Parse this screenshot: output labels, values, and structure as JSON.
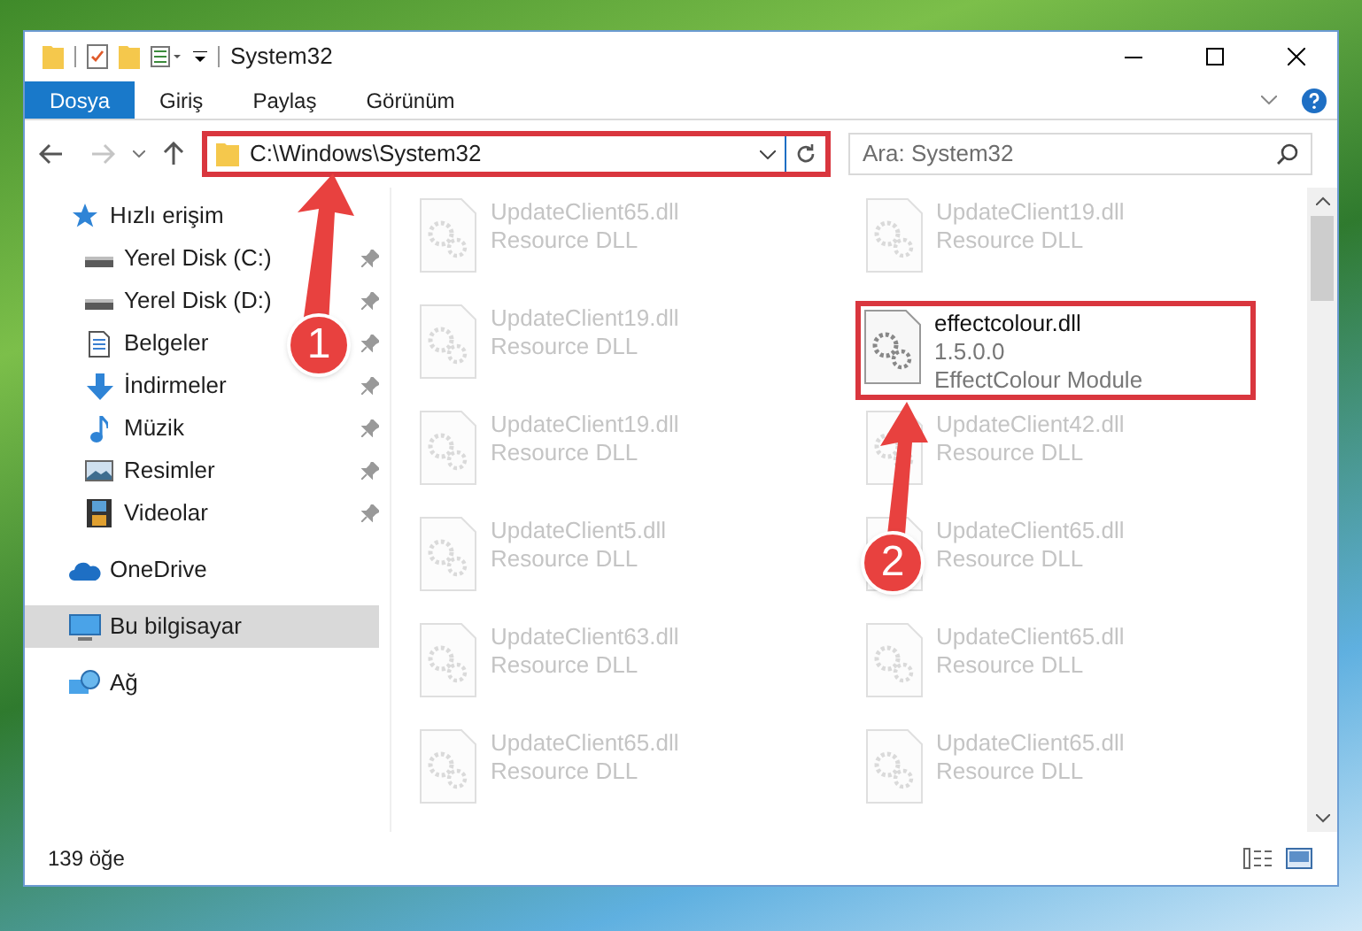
{
  "window": {
    "title": "System32"
  },
  "ribbon_tabs": [
    {
      "label": "Dosya",
      "selected": true
    },
    {
      "label": "Giriş",
      "selected": false
    },
    {
      "label": "Paylaş",
      "selected": false
    },
    {
      "label": "Görünüm",
      "selected": false
    }
  ],
  "address_bar": {
    "path": "C:\\Windows\\System32",
    "highlighted": true
  },
  "search": {
    "placeholder": "Ara: System32"
  },
  "sidebar": {
    "items": [
      {
        "label": "Hızlı erişim",
        "kind": "star",
        "pinned": false,
        "selected": false,
        "children": [
          {
            "label": "Yerel Disk (C:)",
            "kind": "drive",
            "pinned": true,
            "selected": false
          },
          {
            "label": "Yerel Disk (D:)",
            "kind": "drive",
            "pinned": true,
            "selected": false
          },
          {
            "label": "Belgeler",
            "kind": "document",
            "pinned": true,
            "selected": false
          },
          {
            "label": "İndirmeler",
            "kind": "download",
            "pinned": true,
            "selected": false
          },
          {
            "label": "Müzik",
            "kind": "music",
            "pinned": true,
            "selected": false
          },
          {
            "label": "Resimler",
            "kind": "picture",
            "pinned": true,
            "selected": false
          },
          {
            "label": "Videolar",
            "kind": "video",
            "pinned": true,
            "selected": false
          }
        ]
      },
      {
        "label": "OneDrive",
        "kind": "cloud",
        "pinned": false,
        "selected": false
      },
      {
        "label": "Bu bilgisayar",
        "kind": "computer",
        "pinned": false,
        "selected": true
      },
      {
        "label": "Ağ",
        "kind": "network",
        "pinned": false,
        "selected": false
      }
    ]
  },
  "files": [
    {
      "name": "UpdateClient65.dll",
      "description": "Resource DLL",
      "dimmed": true,
      "highlighted": false
    },
    {
      "name": "UpdateClient19.dll",
      "description": "Resource DLL",
      "dimmed": true,
      "highlighted": false
    },
    {
      "name": "UpdateClient19.dll",
      "description": "Resource DLL",
      "dimmed": true,
      "highlighted": false
    },
    {
      "name": "effectcolour.dll",
      "version": "1.5.0.0",
      "description": "EffectColour Module",
      "dimmed": false,
      "highlighted": true
    },
    {
      "name": "UpdateClient19.dll",
      "description": "Resource DLL",
      "dimmed": true,
      "highlighted": false
    },
    {
      "name": "UpdateClient42.dll",
      "description": "Resource DLL",
      "dimmed": true,
      "highlighted": false
    },
    {
      "name": "UpdateClient5.dll",
      "description": "Resource DLL",
      "dimmed": true,
      "highlighted": false
    },
    {
      "name": "UpdateClient65.dll",
      "description": "Resource DLL",
      "dimmed": true,
      "highlighted": false
    },
    {
      "name": "UpdateClient63.dll",
      "description": "Resource DLL",
      "dimmed": true,
      "highlighted": false
    },
    {
      "name": "UpdateClient65.dll",
      "description": "Resource DLL",
      "dimmed": true,
      "highlighted": false
    },
    {
      "name": "UpdateClient65.dll",
      "description": "Resource DLL",
      "dimmed": true,
      "highlighted": false
    },
    {
      "name": "UpdateClient65.dll",
      "description": "Resource DLL",
      "dimmed": true,
      "highlighted": false
    }
  ],
  "status_bar": {
    "count": "139 öğe"
  },
  "annotations": [
    {
      "number": "1"
    },
    {
      "number": "2"
    }
  ]
}
